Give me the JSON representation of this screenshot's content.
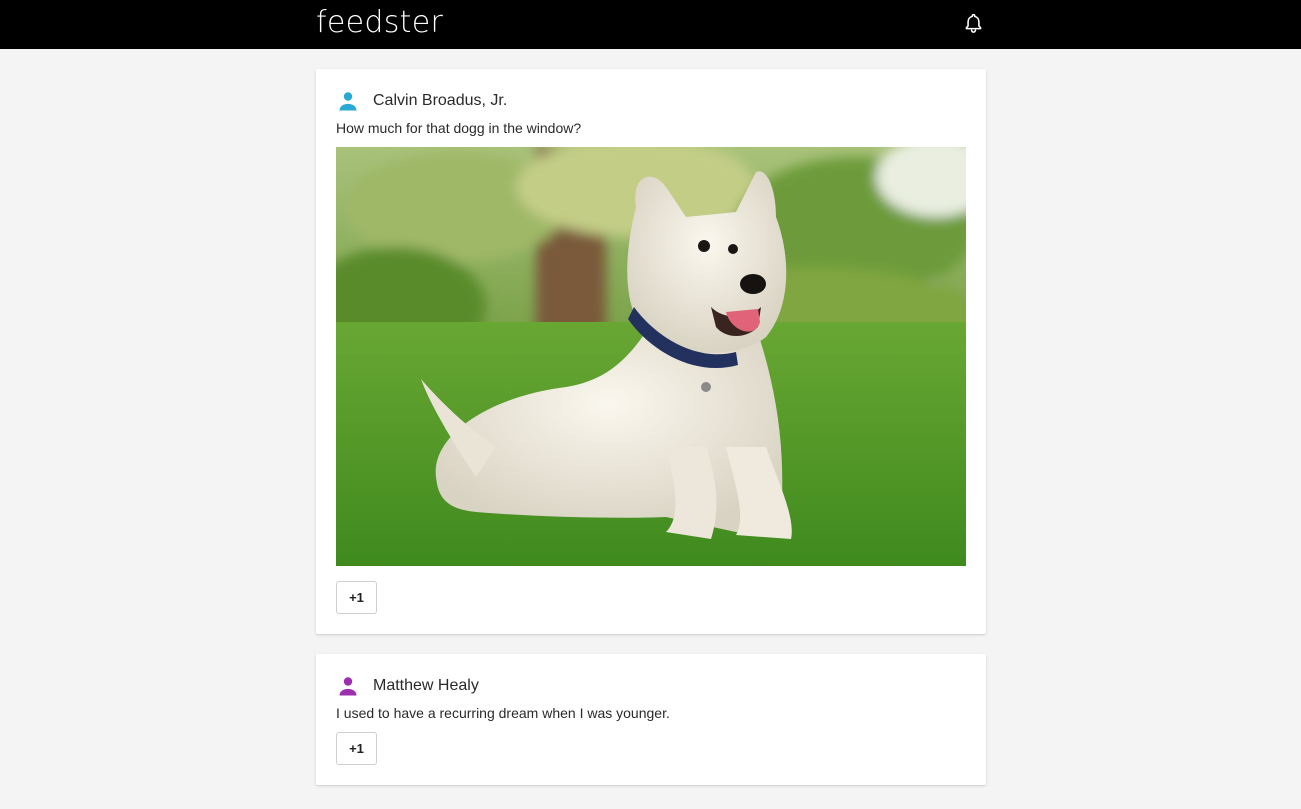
{
  "app": {
    "brand": "feedster",
    "notification_icon": "bell-icon"
  },
  "colors": {
    "topbar": "#000000",
    "background": "#f4f4f4",
    "avatar_1": "#2aa8d4",
    "avatar_2": "#9b2fae"
  },
  "posts": [
    {
      "author": "Calvin Broadus, Jr.",
      "avatar_icon": "user-icon",
      "text": "How much for that dogg in the window?",
      "has_image": true,
      "image_subject": "white terrier dog sitting on grass",
      "vote_label": "+1"
    },
    {
      "author": "Matthew Healy",
      "avatar_icon": "user-icon",
      "text": "I used to have a recurring dream when I was younger.",
      "has_image": false,
      "vote_label": "+1"
    }
  ]
}
